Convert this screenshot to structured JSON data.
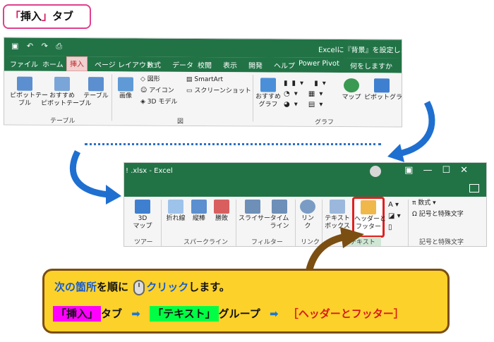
{
  "badge": {
    "bracket_open": "「",
    "word": "挿入",
    "bracket_close": "」",
    "rest": "タブ"
  },
  "top_window": {
    "title": "Excelに『背景』を設定しよ",
    "tabs": [
      "ファイル",
      "ホーム",
      "挿入",
      "ページ レイアウト",
      "数式",
      "データ",
      "校閲",
      "表示",
      "開発",
      "ヘルプ",
      "Power Pivot",
      "何をしますか"
    ],
    "selected_tab": "挿入",
    "buttons": {
      "pivot": "ピボットテー\nブル",
      "recommended_pivot": "おすすめ\nピボットテーブル",
      "table": "テーブル",
      "image": "画像",
      "shapes": "図形",
      "icons": "アイコン",
      "model3d": "3D モデル",
      "smartart": "SmartArt",
      "screenshot": "スクリーンショット",
      "rec_chart": "おすすめ\nグラフ",
      "map": "マップ",
      "pivot_chart": "ピボットグラフ"
    },
    "groups": {
      "table": "テーブル",
      "figure": "図",
      "chart": "グラフ"
    }
  },
  "bottom_window": {
    "title": "! .xlsx  -  Excel",
    "buttons": {
      "map3d": "3D\nマップ",
      "line": "折れ線",
      "column": "縦棒",
      "winloss": "勝敗",
      "slicer": "スライサー",
      "timeline": "タイム\nライン",
      "link": "リン\nク",
      "textbox": "テキスト\nボックス",
      "header_footer": "ヘッダーと\nフッター",
      "equation": "数式",
      "symbol": "記号と特殊文字"
    },
    "groups": {
      "tour": "ツアー",
      "sparkline": "スパークライン",
      "filter": "フィルター",
      "link": "リンク",
      "text": "テキスト",
      "symbols": "記号と特殊文字"
    }
  },
  "callout": {
    "line1_a": "次の",
    "line1_b": "箇所",
    "line1_c": "を順に",
    "line1_d": "クリック",
    "line1_e": "します。",
    "step1": "「挿入」",
    "step1_suffix": "タブ",
    "step2": "「テキスト」",
    "step2_suffix": "グループ",
    "step3": "［ヘッダーとフッター］"
  },
  "colors": {
    "excel_green": "#217346",
    "callout_yellow": "#fcd12a",
    "highlight_red": "#e02020"
  }
}
